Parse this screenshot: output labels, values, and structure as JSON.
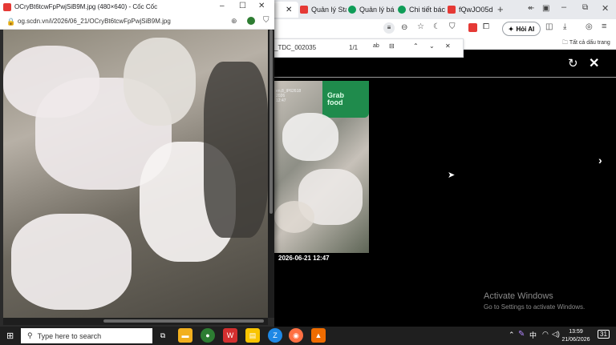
{
  "tabs": [
    {
      "label": "Quản lý Sta",
      "color": "#e53935"
    },
    {
      "label": "Quản lý bá",
      "color": "#0f9d58"
    },
    {
      "label": "Chi tiết bác",
      "color": "#0f9d58"
    },
    {
      "label": "fQwJO05d",
      "color": "#e53935"
    }
  ],
  "toolbar": {
    "ai_label": "Hỏi AI"
  },
  "bookmarks": {
    "all_label": "Tất cả dấu trang"
  },
  "find": {
    "query": "_TDC_002035",
    "count": "1/1"
  },
  "popup": {
    "title": "OCryBt6tcwFpPwjSiB9M.jpg (480×640) - Cốc Cốc",
    "url": "og.scdn.vn/i/2026/06_21/OCryBt6tcwFpPwjSiB9M.jpg"
  },
  "thumbnail": {
    "grab_text": "Grab\nfood",
    "timestamp": "2026-06-21 12:47"
  },
  "watermark": {
    "line1": "Activate Windows",
    "line2": "Go to Settings to activate Windows."
  },
  "taskbar": {
    "search_placeholder": "Type here to search",
    "time": "13:59",
    "date": "21/06/2026",
    "notification_count": "31"
  }
}
